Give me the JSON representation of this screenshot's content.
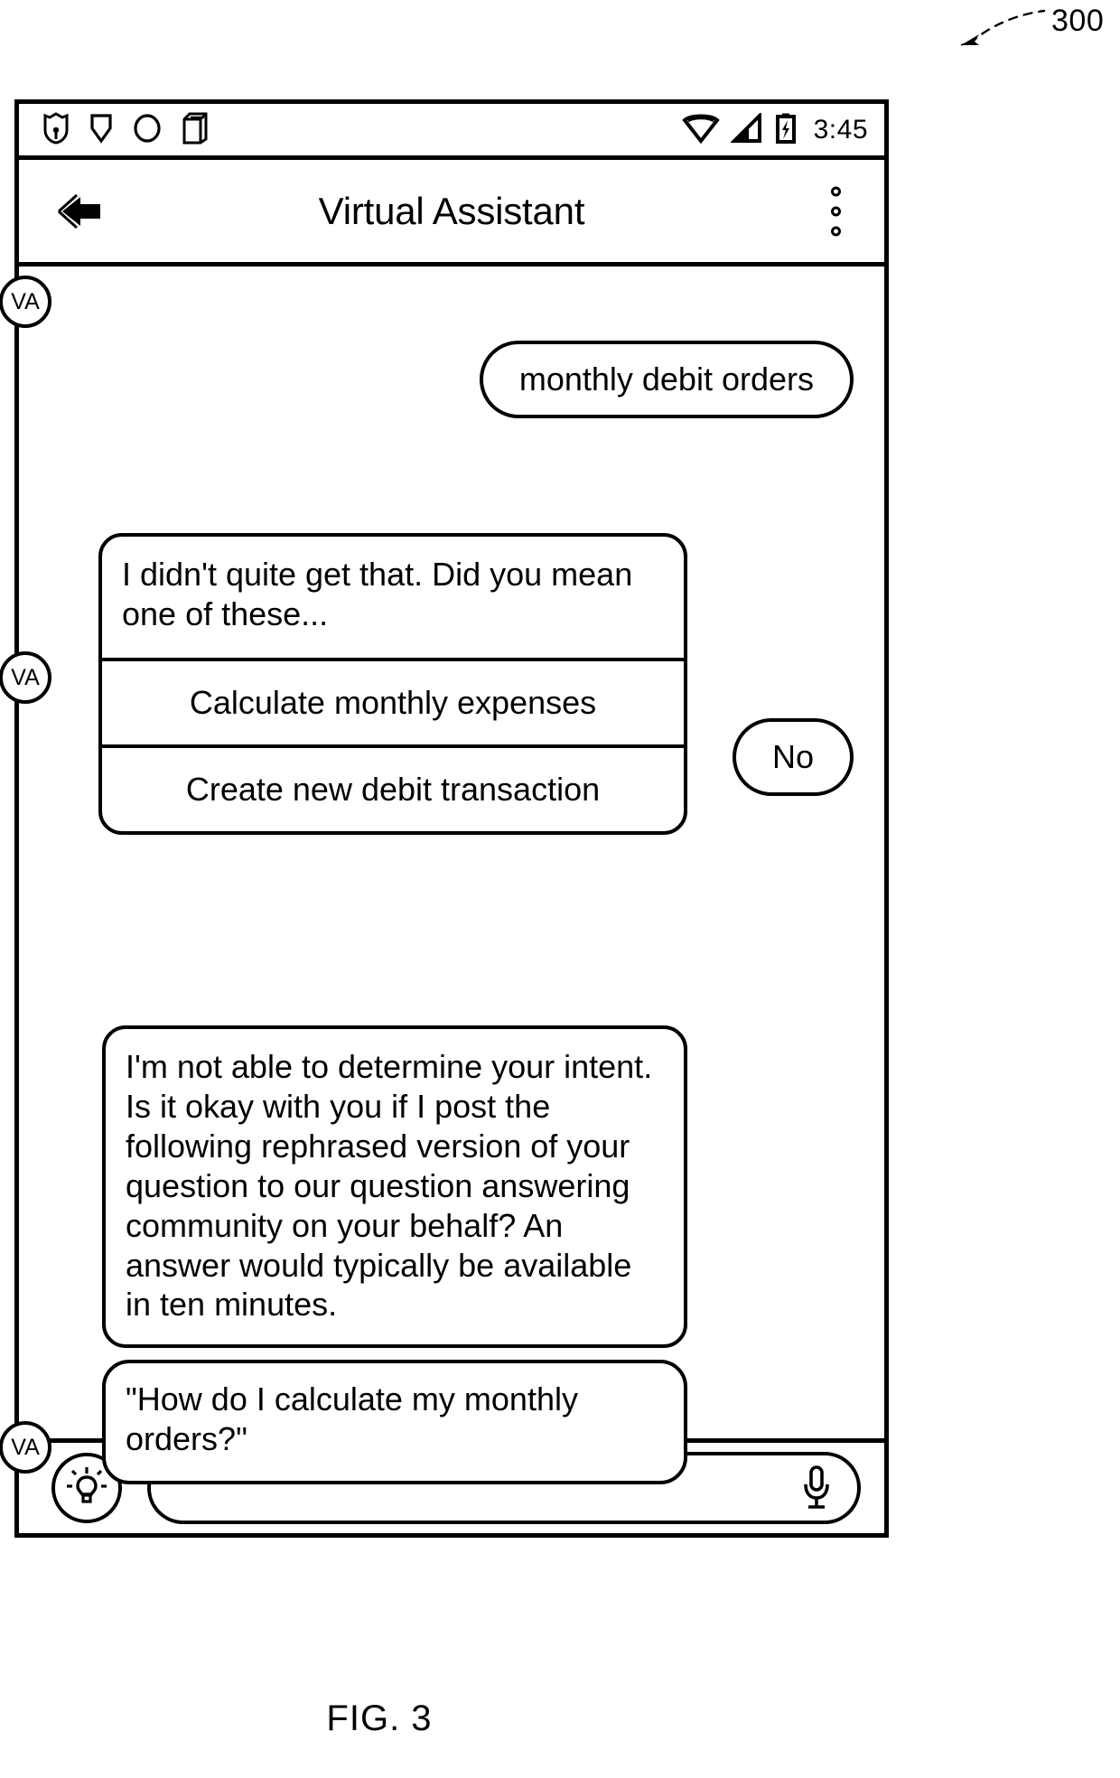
{
  "figure": {
    "reference_numeral": "300",
    "caption": "FIG. 3"
  },
  "status_bar": {
    "left_icons": [
      "shield-badge-icon",
      "shield-outline-icon",
      "circle-icon",
      "sim-card-icon"
    ],
    "right_icons": [
      "wifi-icon",
      "signal-bars-icon",
      "battery-charging-icon"
    ],
    "time": "3:45"
  },
  "app_bar": {
    "back_label": "back-arrow-icon",
    "title": "Virtual Assistant",
    "overflow_label": "overflow-menu-icon"
  },
  "conversation": {
    "avatar_label": "VA",
    "messages": [
      {
        "id": "user-query",
        "sender": "user",
        "text": "monthly debit orders"
      },
      {
        "id": "assistant-disambiguation-card",
        "sender": "assistant",
        "header": "I didn't quite get that. Did you mean one of these...",
        "suggestions": [
          "Calculate monthly expenses",
          "Create new debit transaction"
        ]
      },
      {
        "id": "user-decline",
        "sender": "user",
        "text": "No"
      },
      {
        "id": "assistant-escalation",
        "sender": "assistant",
        "text": "I'm not able to determine your intent. Is it okay with you if I post the following rephrased version of your question to our question answering community on your behalf? An answer would typically be available in ten minutes."
      },
      {
        "id": "assistant-rephrase",
        "sender": "assistant",
        "text": "\"How do I calculate my monthly orders?\""
      }
    ]
  },
  "input_bar": {
    "suggest_icon": "lightbulb-icon",
    "input_value": "",
    "input_placeholder": "",
    "mic_icon": "microphone-icon"
  }
}
